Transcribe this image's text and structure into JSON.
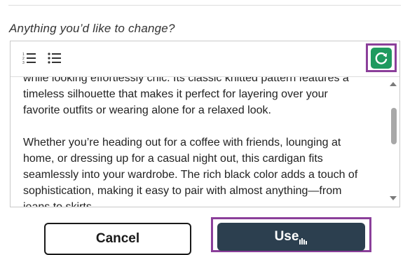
{
  "prompt": {
    "label": "Anything you’d like to change?"
  },
  "editor": {
    "toolbar": {
      "ordered_list_icon": "ordered-list-icon",
      "bullet_list_icon": "bullet-list-icon",
      "regenerate_icon": "refresh-icon"
    },
    "paragraphs": [
      "while looking effortlessly chic. Its classic knitted pattern features a\ntimeless silhouette that makes it perfect for layering over your\nfavorite outfits or wearing alone for a relaxed look.",
      "Whether you’re heading out for a coffee with friends, lounging at\nhome, or dressing up for a casual night out, this cardigan fits\nseamlessly into your wardrobe. The rich black color adds a touch of\nsophistication, making it easy to pair with almost anything—from\njeans to skirts"
    ]
  },
  "actions": {
    "cancel_label": "Cancel",
    "use_label": "Use"
  },
  "colors": {
    "highlight": "#8b3f9a",
    "regenerate": "#1f9a5f",
    "primary_button": "#2c3f4f"
  }
}
